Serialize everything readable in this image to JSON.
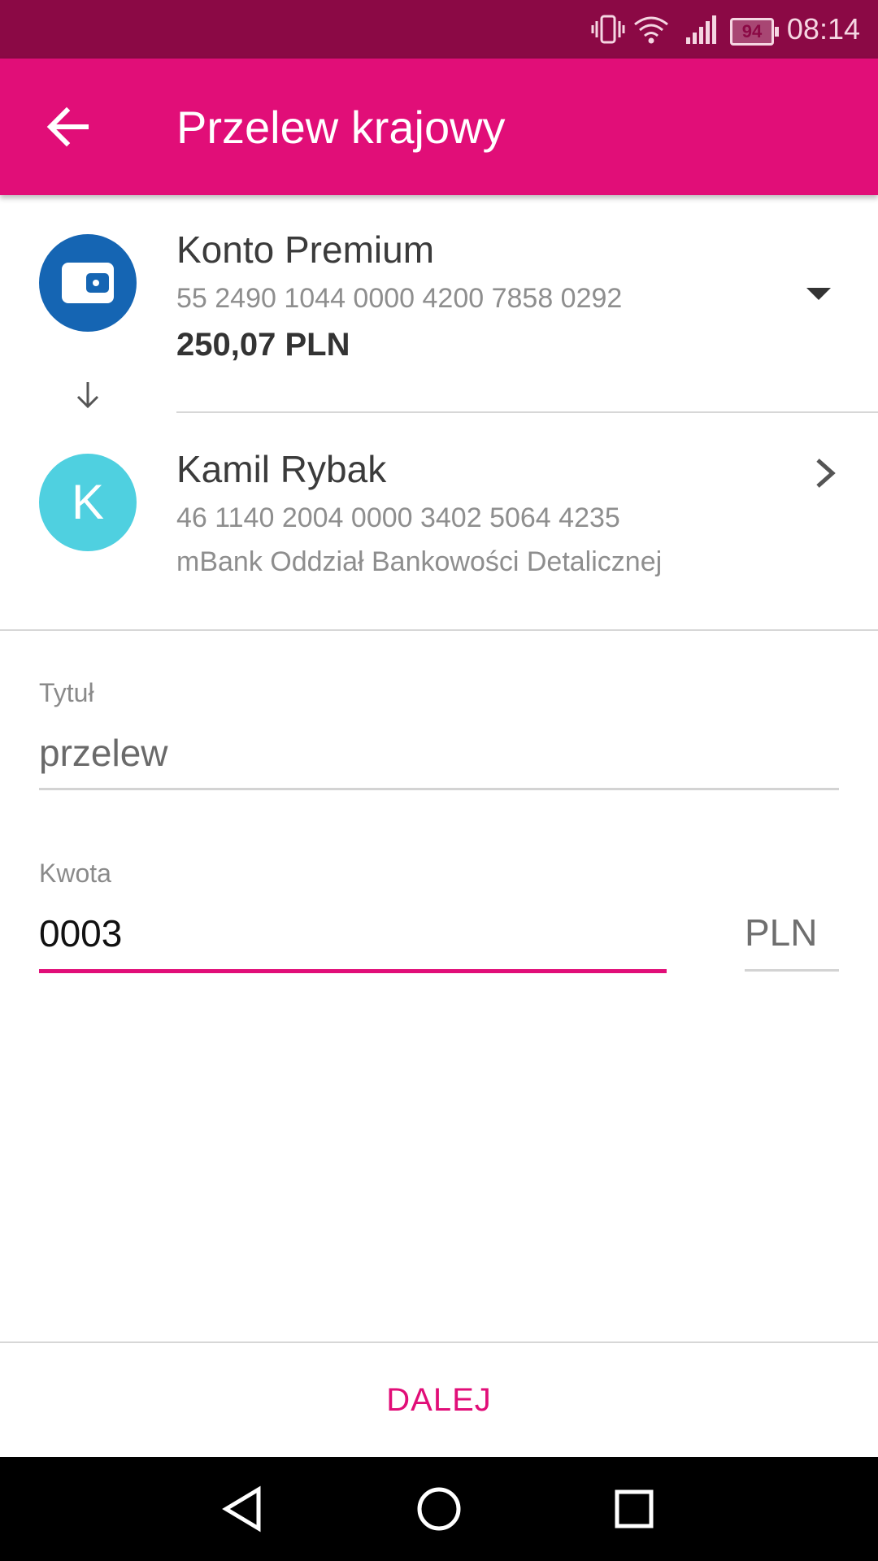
{
  "status_bar": {
    "time": "08:14",
    "battery": "94",
    "icons": [
      "vibrate-icon",
      "wifi-icon",
      "signal-icon",
      "battery-icon"
    ]
  },
  "app_bar": {
    "title": "Przelew krajowy",
    "back_icon": "arrow-back-icon"
  },
  "from_account": {
    "name": "Konto Premium",
    "number": "55 2490 1044 0000 4200 7858 0292",
    "balance": "250,07 PLN",
    "icon": "wallet-icon"
  },
  "recipient": {
    "initial": "K",
    "name": "Kamil Rybak",
    "number": "46 1140 2004 0000 3402 5064 4235",
    "bank": "mBank Oddział Bankowości Detalicznej"
  },
  "form": {
    "title_label": "Tytuł",
    "title_value": "przelew",
    "amount_label": "Kwota",
    "amount_value": "0003",
    "currency": "PLN"
  },
  "actions": {
    "next_label": "DALEJ"
  },
  "colors": {
    "accent": "#e10e78",
    "status_bar": "#8b0945",
    "account_icon_bg": "#1565b3",
    "recipient_avatar_bg": "#4fd0e0"
  }
}
